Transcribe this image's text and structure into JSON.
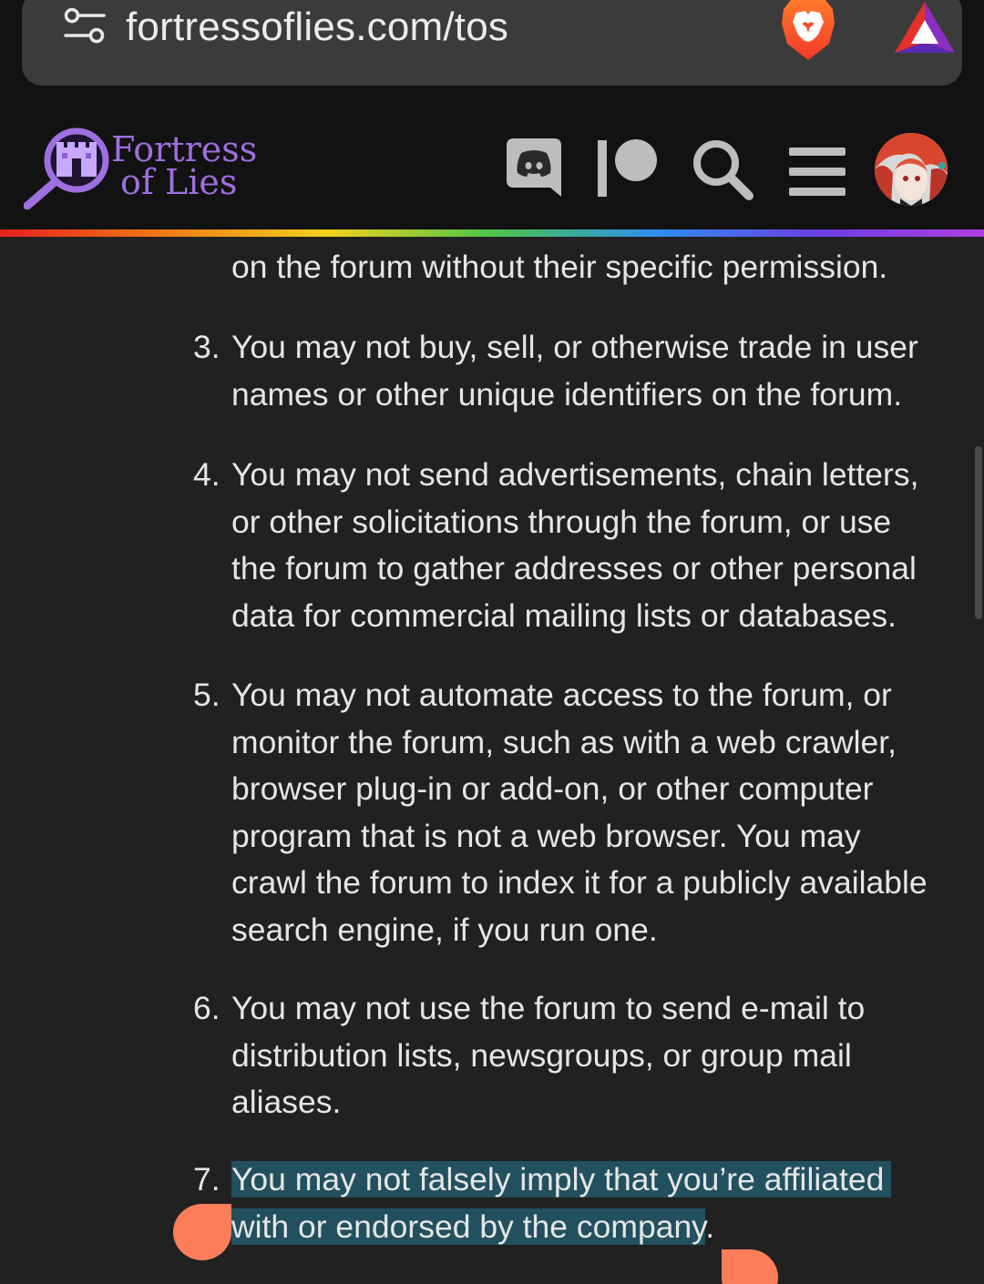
{
  "browser": {
    "url": "fortressoflies.com/tos",
    "icons": [
      "tune-icon",
      "brave-lion-icon",
      "brave-rewards-icon"
    ]
  },
  "site": {
    "logo_line1": "Fortress",
    "logo_line2": "of Lies",
    "nav_icons": [
      "discord-icon",
      "patreon-icon",
      "search-icon",
      "hamburger-menu-icon",
      "avatar"
    ]
  },
  "colors": {
    "accent": "#9f6fe0",
    "selection": "#22505f",
    "handle": "#fb7d5a",
    "background": "#212121"
  },
  "tos": {
    "fragment": "on the forum without their specific permission.",
    "items": [
      {
        "number": "3.",
        "lines": [
          "You may not buy, sell, or otherwise trade in user",
          "names or other unique identifiers on the forum."
        ]
      },
      {
        "number": "4.",
        "lines": [
          "You may not send advertisements, chain letters,",
          "or other solicitations through the forum, or use",
          "the forum to gather addresses or other personal",
          "data for commercial mailing lists or databases."
        ]
      },
      {
        "number": "5.",
        "lines": [
          "You may not automate access to the forum, or",
          "monitor the forum, such as with a web crawler,",
          "browser plug-in or add-on, or other computer",
          "program that is not a web browser. You may",
          "crawl the forum to index it for a publicly available",
          "search engine, if you run one."
        ]
      },
      {
        "number": "6.",
        "lines": [
          "You may not use the forum to send e-mail to",
          "distribution lists, newsgroups, or group mail",
          "aliases."
        ]
      },
      {
        "number": "7.",
        "line1": "You may not falsely imply that you’re affiliated",
        "line2": "with or endorsed by the company",
        "line2_end": "."
      }
    ]
  }
}
